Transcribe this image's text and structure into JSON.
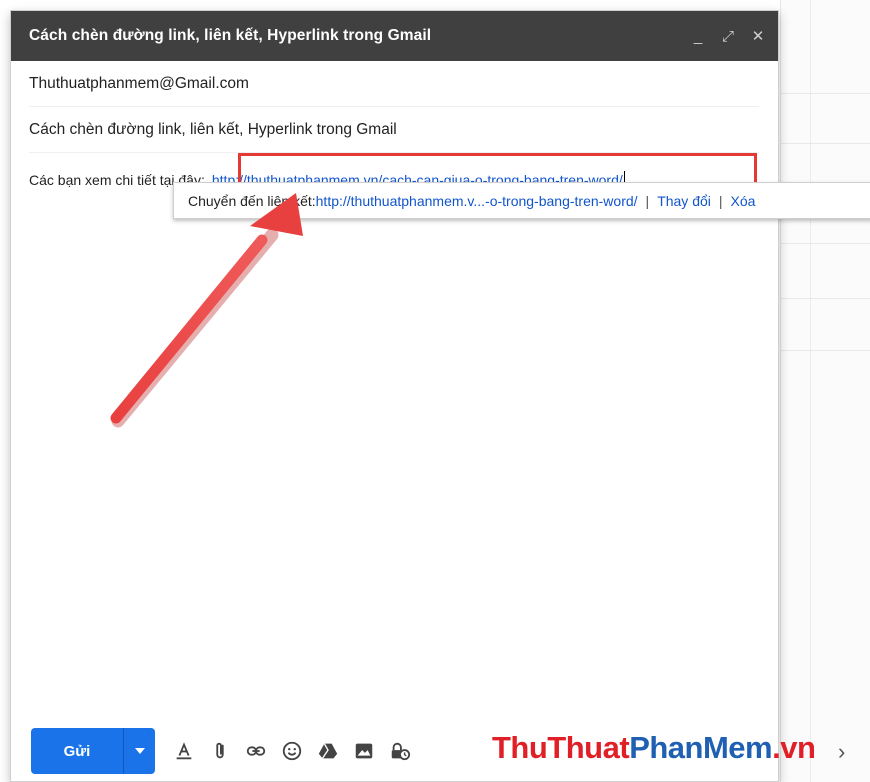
{
  "compose": {
    "title": "Cách chèn đường link, liên kết, Hyperlink trong Gmail",
    "controls": {
      "minimize": "_",
      "expand": "⤢",
      "close": "✕"
    },
    "recipient": "Thuthuatphanmem@Gmail.com",
    "subject": "Cách chèn đường link, liên kết, Hyperlink trong Gmail",
    "body_prefix": "Các bạn xem chi tiết tại đây:",
    "body_link": "http://thuthuatphanmem.vn/cach-can-giua-o-trong-bang-tren-word/"
  },
  "link_tooltip": {
    "label": "Chuyển đến liên kết:",
    "link": "http://thuthuatphanmem.v...-o-trong-bang-tren-word/",
    "separator": "|",
    "change": "Thay đổi",
    "remove": "Xóa"
  },
  "toolbar": {
    "send_label": "Gửi",
    "tools": [
      "format-text-icon",
      "attach-icon",
      "link-icon",
      "emoji-icon",
      "drive-icon",
      "photo-icon",
      "confidential-icon"
    ]
  },
  "watermark": {
    "part1": "ThuThuat",
    "part2": "PhanMem",
    "part3": ".vn",
    "tail": "›"
  },
  "colors": {
    "header_bg": "#404040",
    "send_blue": "#1a73e8",
    "link_blue": "#1155cc",
    "highlight_red": "#e53935"
  }
}
